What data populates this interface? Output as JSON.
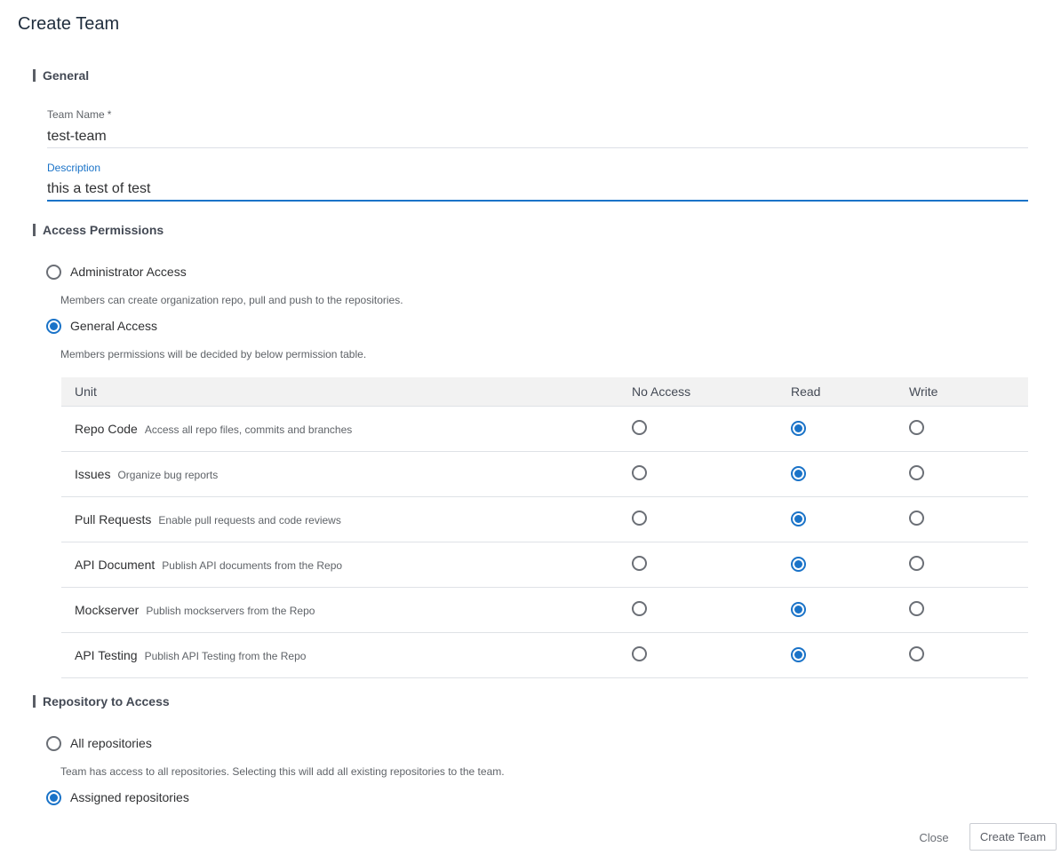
{
  "dialog": {
    "title": "Create Team"
  },
  "general": {
    "section_title": "General",
    "team_name_label": "Team Name",
    "team_name_required": "*",
    "team_name_value": "test-team",
    "description_label": "Description",
    "description_value": "this a test of test"
  },
  "access": {
    "section_title": "Access Permissions",
    "options": [
      {
        "label": "Administrator Access",
        "help": "Members can create organization repo, pull and push to the repositories.",
        "checked": false
      },
      {
        "label": "General Access",
        "help": "Members permissions will be decided by below permission table.",
        "checked": true
      }
    ],
    "table": {
      "headers": {
        "unit": "Unit",
        "no_access": "No Access",
        "read": "Read",
        "write": "Write"
      },
      "rows": [
        {
          "name": "Repo Code",
          "desc": "Access all repo files, commits and branches",
          "selected": "Read"
        },
        {
          "name": "Issues",
          "desc": "Organize bug reports",
          "selected": "Read"
        },
        {
          "name": "Pull Requests",
          "desc": "Enable pull requests and code reviews",
          "selected": "Read"
        },
        {
          "name": "API Document",
          "desc": "Publish API documents from the Repo",
          "selected": "Read"
        },
        {
          "name": "Mockserver",
          "desc": "Publish mockservers from the Repo",
          "selected": "Read"
        },
        {
          "name": "API Testing",
          "desc": "Publish API Testing from the Repo",
          "selected": "Read"
        }
      ]
    }
  },
  "repos": {
    "section_title": "Repository to Access",
    "options": [
      {
        "label": "All repositories",
        "help": "Team has access to all repositories. Selecting this will add all existing repositories to the team.",
        "checked": false
      },
      {
        "label": "Assigned repositories",
        "checked": true
      }
    ]
  },
  "footer": {
    "close_label": "Close",
    "create_label": "Create Team"
  },
  "colors": {
    "accent": "#1a73c8",
    "header_bg": "#f2f2f2",
    "border": "#dfe2e6"
  }
}
